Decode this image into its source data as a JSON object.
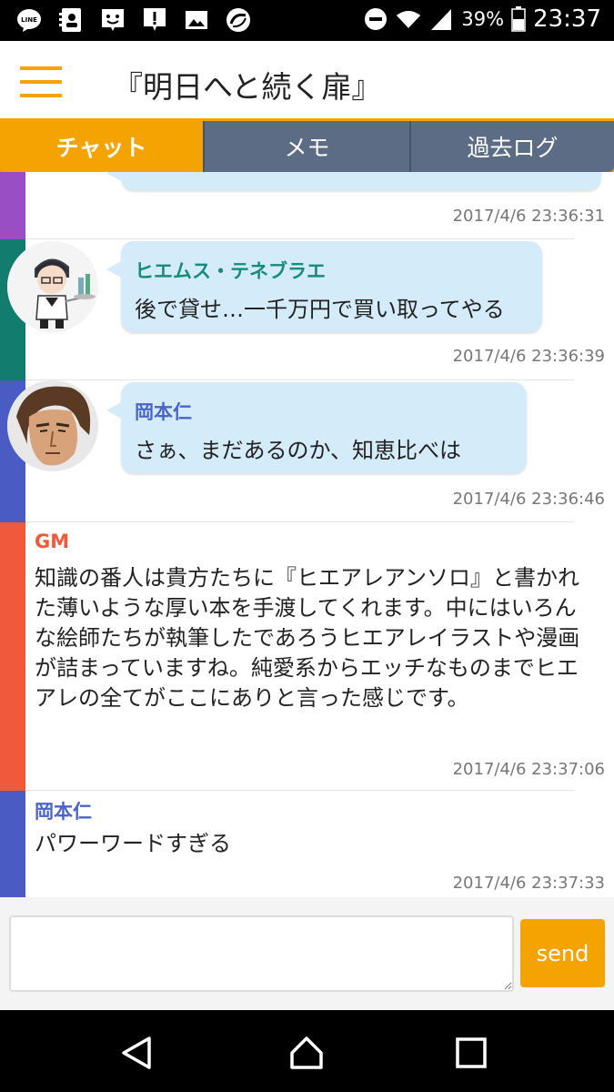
{
  "status_bar": {
    "battery_percent": "39%",
    "time": "23:37",
    "left_icons": [
      "line-icon",
      "contacts-icon",
      "face-notification-icon",
      "alert-icon",
      "image-icon",
      "sync-icon"
    ],
    "right_icons": [
      "do-not-disturb-icon",
      "wifi-icon",
      "signal-icon",
      "battery-icon"
    ]
  },
  "header": {
    "title": "『明日へと続く扉』",
    "menu_icon": "hamburger-icon",
    "accent_color": "#f5a300"
  },
  "tabs": [
    {
      "label": "チャット",
      "active": true
    },
    {
      "label": "メモ",
      "active": false
    },
    {
      "label": "過去ログ",
      "active": false
    }
  ],
  "messages": [
    {
      "type": "bubble-partial",
      "timestamp": "2017/4/6 23:36:31",
      "stripe_color": "#9a4ec4"
    },
    {
      "type": "bubble",
      "name": "ヒエムス・テネブラエ",
      "name_color": "#1a8a7e",
      "text": "後で貸せ…一千万円で買い取ってやる",
      "timestamp": "2017/4/6 23:36:39",
      "stripe_color": "#127d6f"
    },
    {
      "type": "bubble",
      "name": "岡本仁",
      "name_color": "#4a64c8",
      "text": "さぁ、まだあるのか、知恵比べは",
      "timestamp": "2017/4/6 23:36:46",
      "stripe_color": "#4a5bc4"
    },
    {
      "type": "plain",
      "name": "GM",
      "name_color": "#f05a3a",
      "text": "知識の番人は貴方たちに『ヒエアレアンソロ』と書かれた薄いような厚い本を手渡してくれます。中にはいろんな絵師たちが執筆したであろうヒエアレイラストや漫画が詰まっていますね。純愛系からエッチなものまでヒエアレの全てがここにありと言った感じです。",
      "timestamp": "2017/4/6 23:37:06",
      "stripe_color": "#f05a3a"
    },
    {
      "type": "plain",
      "name": "岡本仁",
      "name_color": "#4a64c8",
      "text": "パワーワードすぎる",
      "timestamp": "2017/4/6 23:37:33",
      "stripe_color": "#4a5bc4"
    }
  ],
  "composer": {
    "input_value": "",
    "send_label": "send"
  },
  "nav_bar": {
    "icons": [
      "back-icon",
      "home-icon",
      "recents-icon"
    ]
  }
}
